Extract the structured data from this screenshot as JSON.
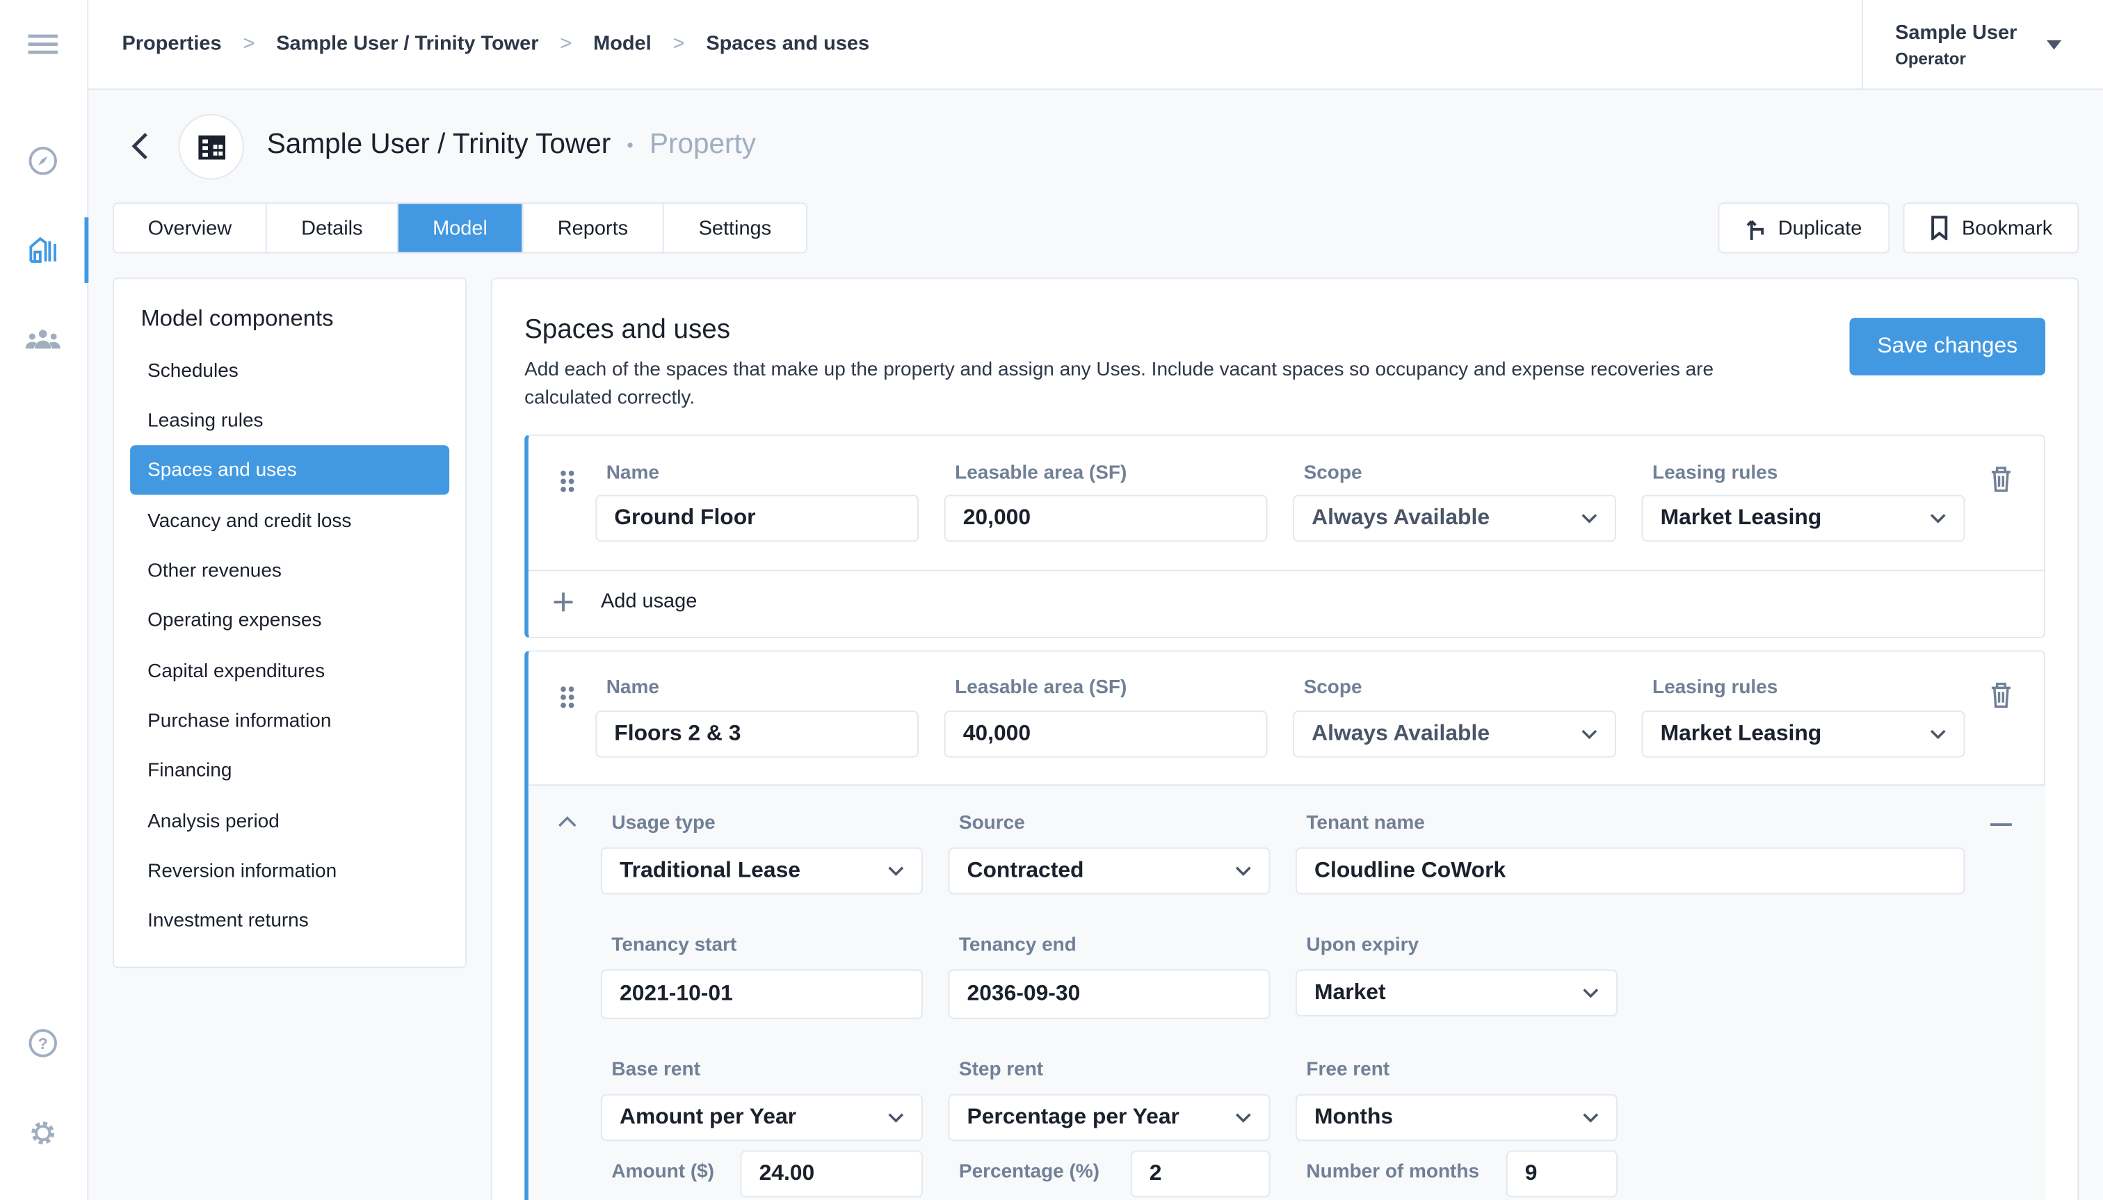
{
  "breadcrumb": [
    "Properties",
    "Sample User / Trinity Tower",
    "Model",
    "Spaces and uses"
  ],
  "user": {
    "name": "Sample User",
    "role": "Operator"
  },
  "header": {
    "title": "Sample User / Trinity Tower",
    "subtitle": "Property"
  },
  "tabs": [
    {
      "label": "Overview"
    },
    {
      "label": "Details"
    },
    {
      "label": "Model",
      "active": true
    },
    {
      "label": "Reports"
    },
    {
      "label": "Settings"
    }
  ],
  "actions": {
    "duplicate": "Duplicate",
    "bookmark": "Bookmark"
  },
  "accent_color": "#4299e1",
  "model_components": {
    "title": "Model components",
    "items": [
      "Schedules",
      "Leasing rules",
      "Spaces and uses",
      "Vacancy and credit loss",
      "Other revenues",
      "Operating expenses",
      "Capital expenditures",
      "Purchase information",
      "Financing",
      "Analysis period",
      "Reversion information",
      "Investment returns"
    ],
    "active": "Spaces and uses"
  },
  "main": {
    "title": "Spaces and uses",
    "description": "Add each of the spaces that make up the property and assign any Uses. Include vacant spaces so occupancy and expense recoveries are calculated correctly.",
    "save": "Save changes"
  },
  "space_labels": {
    "name": "Name",
    "area": "Leasable area (SF)",
    "scope": "Scope",
    "leasing": "Leasing rules"
  },
  "spaces": [
    {
      "name": "Ground Floor",
      "area": "20,000",
      "scope": "Always Available",
      "leasing": "Market Leasing",
      "add_usage": "Add usage"
    },
    {
      "name": "Floors 2 & 3",
      "area": "40,000",
      "scope": "Always Available",
      "leasing": "Market Leasing"
    }
  ],
  "usage": {
    "usage_type_label": "Usage type",
    "usage_type": "Traditional Lease",
    "source_label": "Source",
    "source": "Contracted",
    "tenant_label": "Tenant name",
    "tenant": "Cloudline CoWork",
    "start_label": "Tenancy start",
    "start": "2021-10-01",
    "end_label": "Tenancy end",
    "end": "2036-09-30",
    "expiry_label": "Upon expiry",
    "expiry": "Market",
    "base_label": "Base rent",
    "base": "Amount per Year",
    "step_label": "Step rent",
    "step": "Percentage per Year",
    "free_label": "Free rent",
    "free": "Months",
    "amount_label": "Amount ($)",
    "amount": "24.00",
    "pct_label": "Percentage (%)",
    "pct": "2",
    "months_label": "Number of months",
    "months": "9"
  }
}
